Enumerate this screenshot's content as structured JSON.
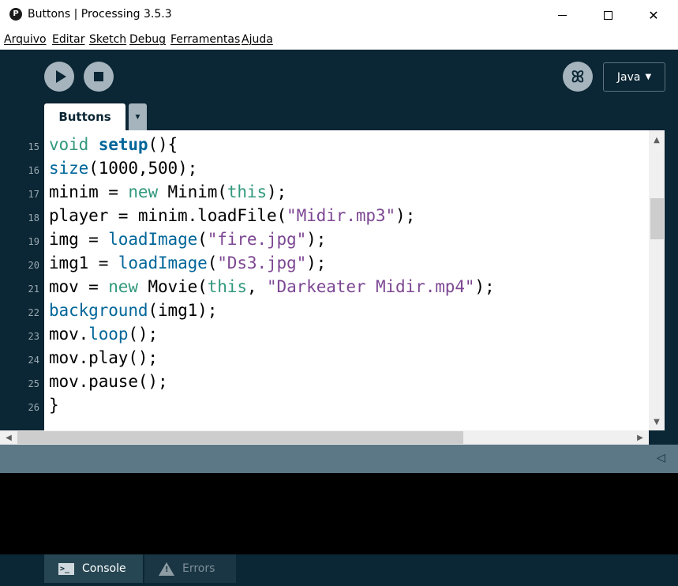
{
  "window": {
    "title": "Buttons | Processing 3.5.3",
    "app_icon": "processing-logo-icon",
    "icon_letter": "P"
  },
  "menu": [
    "Arquivo",
    "Editar",
    "Sketch",
    "Debug",
    "Ferramentas",
    "Ajuda"
  ],
  "toolbar": {
    "run_icon": "play-icon",
    "stop_icon": "stop-icon",
    "debug_icon": "debugger-icon",
    "mode": "Java"
  },
  "tabs": [
    {
      "label": "Buttons",
      "active": true
    }
  ],
  "editor": {
    "lines": [
      {
        "no": "15"
      },
      {
        "no": "16"
      },
      {
        "no": "17"
      },
      {
        "no": "18"
      },
      {
        "no": "19"
      },
      {
        "no": "20"
      },
      {
        "no": "21"
      },
      {
        "no": "22"
      },
      {
        "no": "23"
      },
      {
        "no": "24"
      },
      {
        "no": "25"
      },
      {
        "no": "26"
      }
    ],
    "code": {
      "l15": {
        "a": "void",
        "b": " ",
        "c": "setup",
        "d": "(){"
      },
      "l16": {
        "a": "size",
        "b": "(1000,500);"
      },
      "l17": {
        "a": "minim = ",
        "b": "new",
        "c": " Minim(",
        "d": "this",
        "e": ");"
      },
      "l18": {
        "a": "player = minim.loadFile(",
        "b": "\"Midir.mp3\"",
        "c": ");"
      },
      "l19": {
        "a": "img = ",
        "b": "loadImage",
        "c": "(",
        "d": "\"fire.jpg\"",
        "e": ");"
      },
      "l20": {
        "a": "img1 = ",
        "b": "loadImage",
        "c": "(",
        "d": "\"Ds3.jpg\"",
        "e": ");"
      },
      "l21": {
        "a": "mov = ",
        "b": "new",
        "c": " Movie(",
        "d": "this",
        "e": ", ",
        "f": "\"Darkeater Midir.mp4\"",
        "g": ");"
      },
      "l22": {
        "a": "background",
        "b": "(img1);"
      },
      "l23": {
        "a": "mov.",
        "b": "loop",
        "c": "();"
      },
      "l24": {
        "a": "mov.play();"
      },
      "l25": {
        "a": "mov.pause();"
      },
      "l26": {
        "a": "}"
      }
    }
  },
  "footer": {
    "console_label": "Console",
    "errors_label": "Errors",
    "console_icon": "console-icon",
    "errors_icon": "warning-icon"
  },
  "colors": {
    "background": "#0b2634",
    "keyword": "#33997e",
    "function": "#006699",
    "string": "#7d4793"
  }
}
